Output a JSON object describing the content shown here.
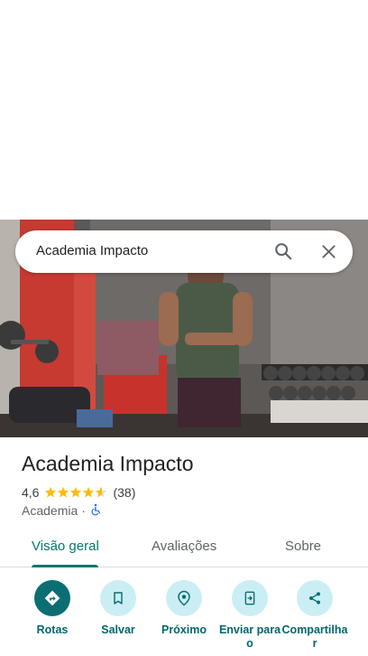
{
  "search": {
    "query": "Academia Impacto",
    "search_icon": "search-icon",
    "close_icon": "close-icon"
  },
  "place": {
    "title": "Academia Impacto",
    "rating": "4,6",
    "stars": 4.6,
    "review_count": "(38)",
    "category": "Academia",
    "separator": "·",
    "accessibility_icon": "wheelchair-icon"
  },
  "tabs": [
    {
      "label": "Visão geral",
      "active": true
    },
    {
      "label": "Avaliações",
      "active": false
    },
    {
      "label": "Sobre",
      "active": false
    }
  ],
  "actions": [
    {
      "label": "Rotas",
      "icon": "directions-icon"
    },
    {
      "label": "Salvar",
      "icon": "bookmark-icon"
    },
    {
      "label": "Próximo",
      "icon": "nearby-icon"
    },
    {
      "label": "Enviar para o",
      "icon": "send-to-phone-icon"
    },
    {
      "label": "Compartilhar",
      "icon": "share-icon"
    }
  ],
  "colors": {
    "accent": "#00796b",
    "action_bg": "#cbeef5",
    "primary_action": "#0b6e73",
    "star": "#fbbc04"
  }
}
